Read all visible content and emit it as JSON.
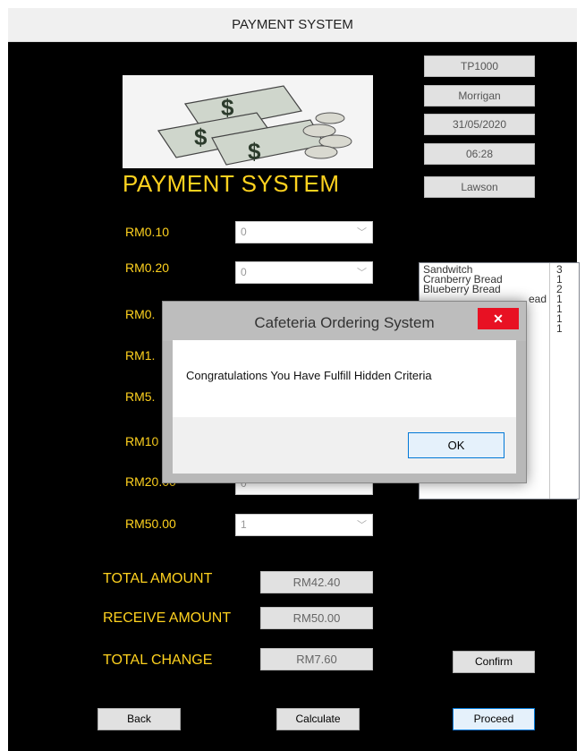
{
  "window": {
    "title": "PAYMENT SYSTEM"
  },
  "info": {
    "staff_id": "TP1000",
    "name": "Morrigan",
    "date": "31/05/2020",
    "time": "06:28",
    "location": "Lawson"
  },
  "logo": {
    "title": "PAYMENT SYSTEM"
  },
  "denominations": [
    {
      "label": "RM0.10",
      "value": "0"
    },
    {
      "label": "RM0.20",
      "value": "0"
    },
    {
      "label": "RM0.",
      "value": ""
    },
    {
      "label": "RM1.",
      "value": ""
    },
    {
      "label": "RM5.",
      "value": ""
    },
    {
      "label": "RM10",
      "value": ""
    },
    {
      "label": "RM20.00",
      "value": "0"
    },
    {
      "label": "RM50.00",
      "value": "1"
    }
  ],
  "order_list": {
    "items": [
      {
        "name": "Sandwitch",
        "qty": "3"
      },
      {
        "name": "Cranberry Bread",
        "qty": "1"
      },
      {
        "name": "Blueberry Bread",
        "qty": "2"
      },
      {
        "name": "ead",
        "qty": "1"
      },
      {
        "name": "",
        "qty": "1"
      },
      {
        "name": "",
        "qty": "1"
      },
      {
        "name": "",
        "qty": "1"
      }
    ]
  },
  "summary": {
    "total_label": "TOTAL AMOUNT",
    "total_value": "RM42.40",
    "receive_label": "RECEIVE AMOUNT",
    "receive_value": "RM50.00",
    "change_label": "TOTAL CHANGE",
    "change_value": "RM7.60"
  },
  "buttons": {
    "confirm": "Confirm",
    "back": "Back",
    "calculate": "Calculate",
    "proceed": "Proceed"
  },
  "dialog": {
    "title": "Cafeteria Ordering System",
    "message": "Congratulations You Have Fulfill Hidden Criteria",
    "ok": "OK",
    "close_glyph": "✕"
  },
  "icons": {
    "combo_arrow": "chevron-down-icon",
    "close": "close-icon",
    "logo": "money-stack-icon"
  },
  "colors": {
    "background": "#000000",
    "accent": "#ffd21f",
    "close_button": "#e81123",
    "focus_border": "#0078d7"
  }
}
